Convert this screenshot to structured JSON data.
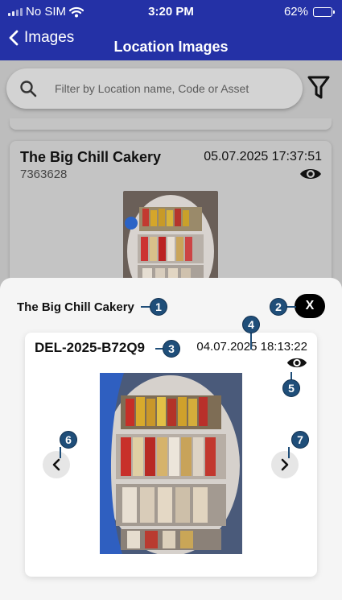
{
  "status_bar": {
    "carrier": "No SIM",
    "time": "3:20 PM",
    "battery": "62%"
  },
  "nav": {
    "back_label": "Images",
    "title": "Location Images"
  },
  "search": {
    "placeholder": "Filter by Location name, Code or Asset",
    "value": ""
  },
  "list": {
    "cards": [
      {
        "location": "The Big Chill Cakery",
        "code": "7363628",
        "datetime": "05.07.2025 17:37:51"
      }
    ]
  },
  "sheet": {
    "title": "The Big Chill Cakery",
    "close_label": "X",
    "image": {
      "code": "DEL-2025-B72Q9",
      "datetime": "04.07.2025 18:13:22"
    }
  },
  "callouts": [
    "1",
    "2",
    "3",
    "4",
    "5",
    "6",
    "7"
  ],
  "icons": {
    "back": "chevron-left-icon",
    "search": "search-icon",
    "filter": "filter-icon",
    "view": "eye-icon",
    "prev": "chevron-left-icon",
    "next": "chevron-right-icon"
  },
  "colors": {
    "header": "#2431a6",
    "callout": "#1f4e79",
    "close_button": "#000000"
  }
}
